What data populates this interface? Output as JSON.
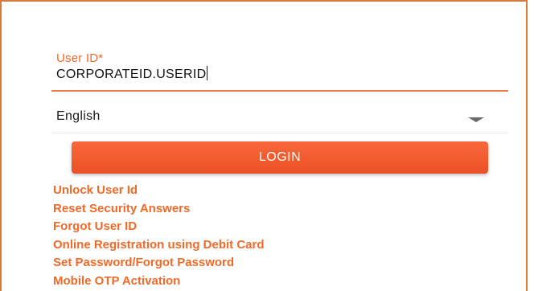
{
  "login_form": {
    "user_id": {
      "label": "User ID*",
      "value": "CORPORATEID.USERID"
    },
    "language": {
      "selected": "English"
    },
    "login_button_label": "LOGIN"
  },
  "links": [
    "Unlock User Id",
    "Reset Security Answers",
    "Forgot User ID",
    "Online Registration using Debit Card",
    "Set Password/Forgot Password",
    "Mobile OTP Activation"
  ],
  "colors": {
    "accent": "#f06a2a",
    "button": "#f15a2c",
    "frame_border": "#d97a3a"
  }
}
